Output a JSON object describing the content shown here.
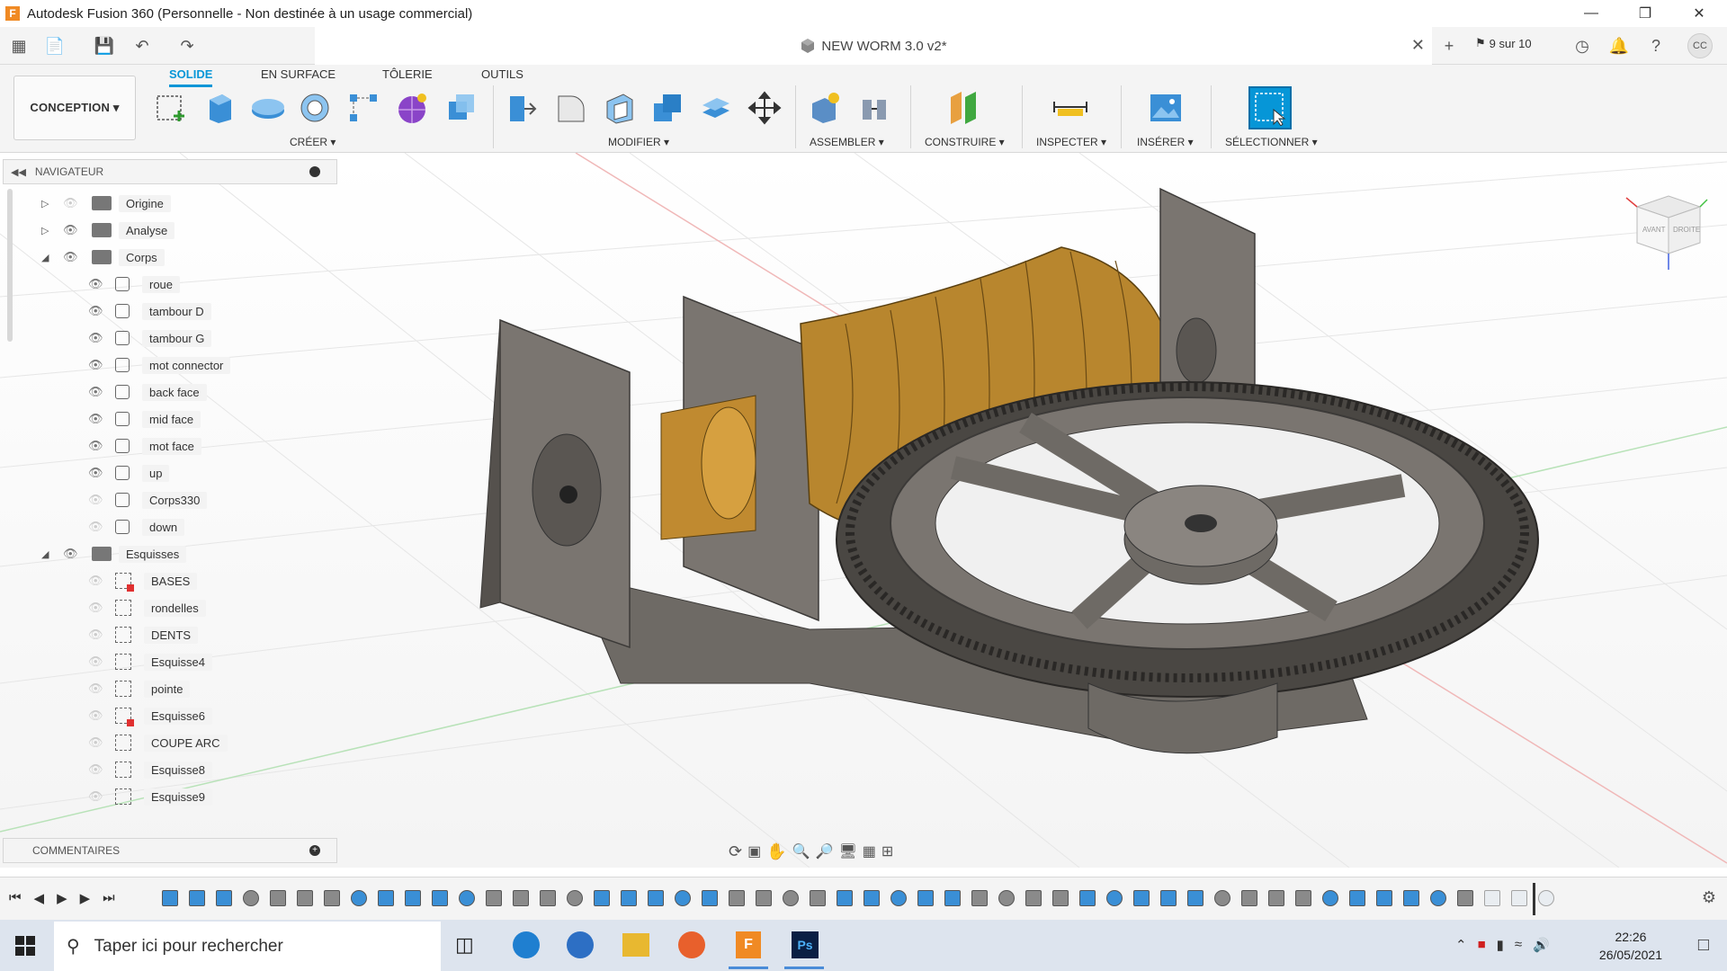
{
  "window": {
    "title": "Autodesk Fusion 360 (Personnelle - Non destinée à un usage commercial)",
    "app_icon_letter": "F"
  },
  "qat": {
    "doc_title": "NEW WORM 3.0 v2*",
    "job_status": "9 sur 10",
    "user_initials": "CC"
  },
  "ribbon": {
    "workspace": "CONCEPTION ▾",
    "tabs": [
      "SOLIDE",
      "EN SURFACE",
      "TÔLERIE",
      "OUTILS"
    ],
    "active_tab": 0,
    "groups": [
      "CRÉER ▾",
      "MODIFIER ▾",
      "ASSEMBLER ▾",
      "CONSTRUIRE ▾",
      "INSPECTER ▾",
      "INSÉRER ▾",
      "SÉLECTIONNER ▾"
    ]
  },
  "navigator": {
    "title": "NAVIGATEUR",
    "folders": [
      "Origine",
      "Analyse",
      "Corps",
      "Esquisses"
    ],
    "bodies": [
      "roue",
      "tambour D",
      "tambour G",
      "mot connector",
      "back face",
      "mid face",
      "mot face",
      "up",
      "Corps330",
      "down"
    ],
    "sketches": [
      "BASES",
      "rondelles",
      "DENTS",
      "Esquisse4",
      "pointe",
      "Esquisse6",
      "COUPE ARC",
      "Esquisse8",
      "Esquisse9"
    ]
  },
  "comments": {
    "title": "COMMENTAIRES"
  },
  "viewcube": {
    "faces": [
      "AVANT",
      "DROITE"
    ]
  },
  "taskbar": {
    "search_placeholder": "Taper ici pour rechercher",
    "time": "22:26",
    "date": "26/05/2021"
  },
  "colors": {
    "accent": "#0696d7",
    "body_grey": "#6e6a65",
    "body_gold": "#b8862e"
  }
}
